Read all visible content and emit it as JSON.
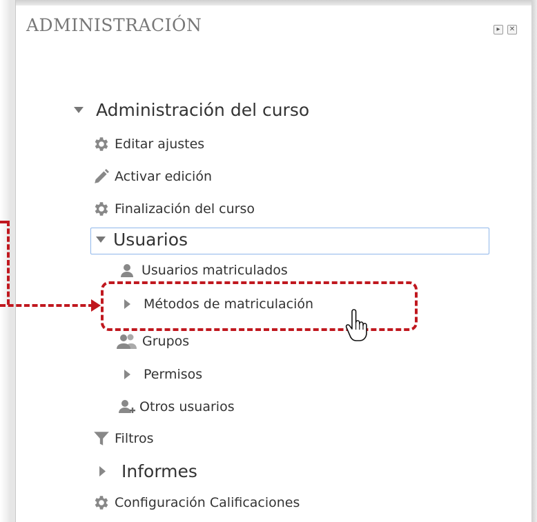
{
  "block": {
    "title": "ADMINISTRACIÓN",
    "dock_button": "▸",
    "close_button": "✕"
  },
  "tree": {
    "course_admin": "Administración del curso",
    "edit_settings": "Editar ajustes",
    "turn_editing_on": "Activar edición",
    "course_completion": "Finalización del curso",
    "users": "Usuarios",
    "enrolled_users": "Usuarios matriculados",
    "enrolment_methods": "Métodos de matriculación",
    "groups": "Grupos",
    "permissions": "Permisos",
    "other_users": "Otros usuarios",
    "filters": "Filtros",
    "reports": "Informes",
    "gradebook_setup": "Configuración Calificaciones"
  },
  "colors": {
    "highlight": "#c0181f",
    "focus_border": "#8fb6ea",
    "text": "#333333",
    "title": "#777777"
  }
}
